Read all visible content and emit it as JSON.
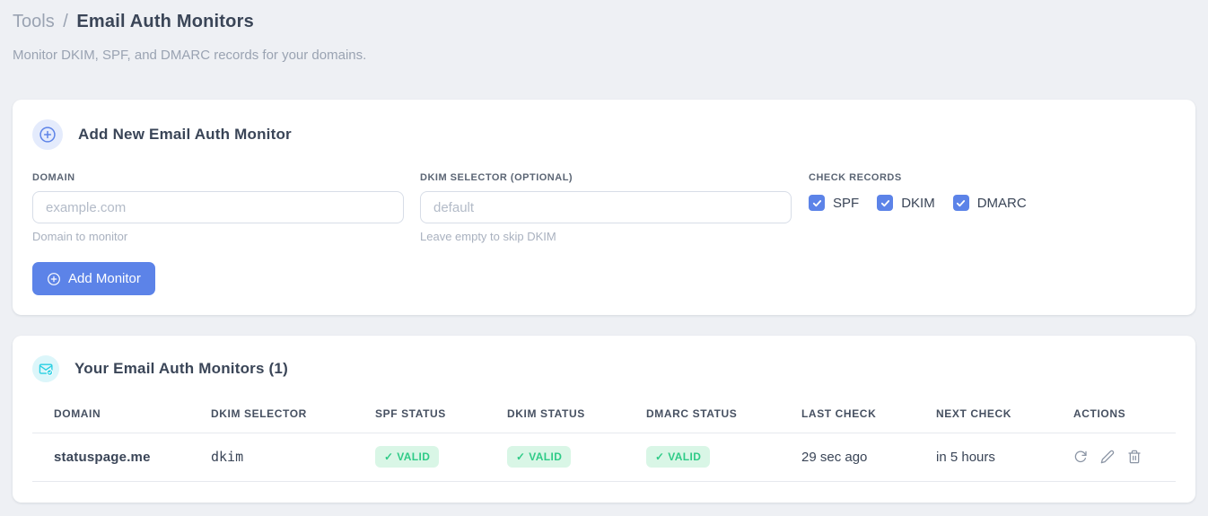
{
  "page": {
    "breadcrumb_root": "Tools",
    "breadcrumb_separator": "/",
    "title": "Email Auth Monitors",
    "subtitle": "Monitor DKIM, SPF, and DMARC records for your domains."
  },
  "add_monitor_card": {
    "title": "Add New Email Auth Monitor",
    "icon": "plus-circle-icon",
    "fields": {
      "domain": {
        "label": "DOMAIN",
        "value": "",
        "placeholder": "example.com",
        "helper": "Domain to monitor"
      },
      "dkim_selector": {
        "label": "DKIM SELECTOR (OPTIONAL)",
        "value": "",
        "placeholder": "default",
        "helper": "Leave empty to skip DKIM"
      }
    },
    "check_records": {
      "label": "CHECK RECORDS",
      "options": [
        {
          "label": "SPF",
          "checked": true
        },
        {
          "label": "DKIM",
          "checked": true
        },
        {
          "label": "DMARC",
          "checked": true
        }
      ]
    },
    "submit_label": "Add Monitor"
  },
  "monitors_card": {
    "title": "Your Email Auth Monitors (1)",
    "icon": "envelope-check-icon",
    "table": {
      "headers": [
        "DOMAIN",
        "DKIM SELECTOR",
        "SPF STATUS",
        "DKIM STATUS",
        "DMARC STATUS",
        "LAST CHECK",
        "NEXT CHECK",
        "ACTIONS"
      ],
      "rows": [
        {
          "domain": "statuspage.me",
          "dkim_selector": "dkim",
          "spf_status": "✓ VALID",
          "dkim_status": "✓ VALID",
          "dmarc_status": "✓ VALID",
          "last_check": "29 sec ago",
          "next_check": "in 5 hours",
          "action_icons": [
            "refresh-icon",
            "edit-icon",
            "delete-icon"
          ]
        }
      ]
    }
  },
  "colors": {
    "accent_blue": "#5c83e8",
    "accent_blue_bg": "#e4ebfc",
    "teal": "#29cfe2",
    "teal_bg": "#dcf6fa",
    "valid_green": "#2fcb87",
    "valid_green_bg": "#d9f6e6",
    "code_pink": "#e83e8c",
    "page_bg": "#eef0f4"
  }
}
